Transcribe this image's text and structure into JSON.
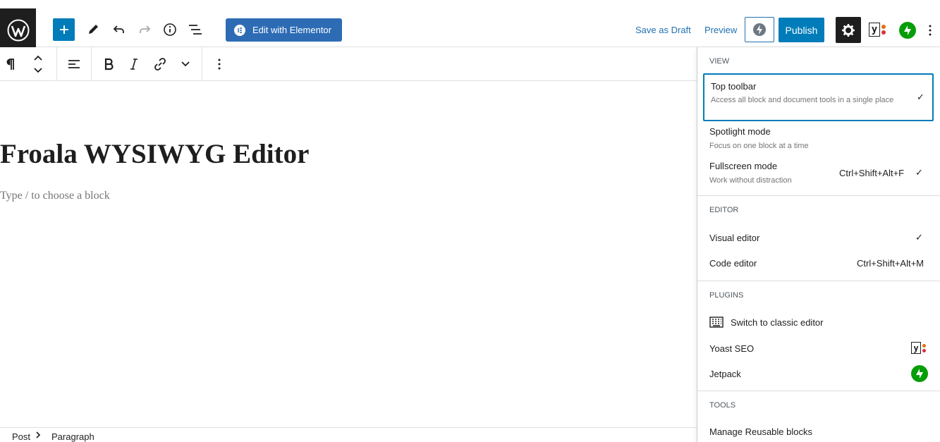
{
  "topbar": {
    "elementor_label": "Edit with Elementor",
    "save_draft_label": "Save as Draft",
    "preview_label": "Preview",
    "publish_label": "Publish",
    "colors": {
      "accent": "#007cba",
      "elementor": "#2d6cb5",
      "jetpack": "#069e08",
      "dark": "#1e1e1e"
    }
  },
  "editor": {
    "title": "Froala WYSIWYG Editor",
    "placeholder": "Type / to choose a block"
  },
  "footer": {
    "crumb_1": "Post",
    "crumb_2": "Paragraph"
  },
  "menu": {
    "view": {
      "label": "VIEW",
      "items": [
        {
          "label": "Top toolbar",
          "desc": "Access all block and document tools in a single place",
          "checked": true,
          "shortcut": ""
        },
        {
          "label": "Spotlight mode",
          "desc": "Focus on one block at a time",
          "checked": false,
          "shortcut": ""
        },
        {
          "label": "Fullscreen mode",
          "desc": "Work without distraction",
          "checked": true,
          "shortcut": "Ctrl+Shift+Alt+F"
        }
      ]
    },
    "editor": {
      "label": "EDITOR",
      "items": [
        {
          "label": "Visual editor",
          "checked": true,
          "shortcut": ""
        },
        {
          "label": "Code editor",
          "checked": false,
          "shortcut": "Ctrl+Shift+Alt+M"
        }
      ]
    },
    "plugins": {
      "label": "PLUGINS",
      "items": [
        {
          "label": "Switch to classic editor",
          "icon": "keyboard-icon"
        },
        {
          "label": "Yoast SEO",
          "icon": "yoast-icon"
        },
        {
          "label": "Jetpack",
          "icon": "jetpack-icon"
        }
      ]
    },
    "tools": {
      "label": "TOOLS",
      "items": [
        {
          "label": "Manage Reusable blocks"
        }
      ]
    }
  }
}
